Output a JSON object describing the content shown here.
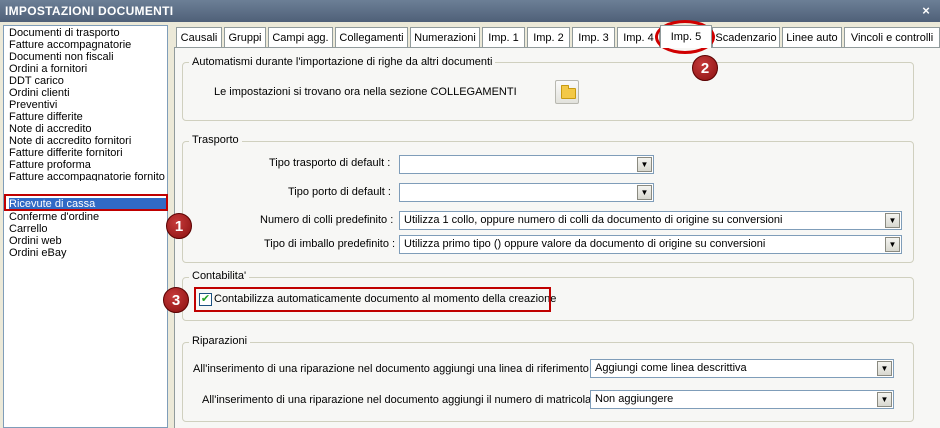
{
  "window": {
    "title": "IMPOSTAZIONI DOCUMENTI",
    "close_label": "×"
  },
  "sidebar": {
    "items": [
      {
        "label": "Documenti di trasporto"
      },
      {
        "label": "Fatture accompagnatorie"
      },
      {
        "label": "Documenti non fiscali"
      },
      {
        "label": "Ordini a fornitori"
      },
      {
        "label": "DDT carico"
      },
      {
        "label": "Ordini clienti"
      },
      {
        "label": "Preventivi"
      },
      {
        "label": "Fatture differite"
      },
      {
        "label": "Note di accredito"
      },
      {
        "label": "Note di accredito fornitori"
      },
      {
        "label": "Fatture differite fornitori"
      },
      {
        "label": "Fatture proforma"
      },
      {
        "label": "Fatture accompagnatorie fornito"
      },
      {
        "label": "Ricevute di cassa"
      },
      {
        "label": "Conferme d'ordine"
      },
      {
        "label": "Carrello"
      },
      {
        "label": "Ordini web"
      },
      {
        "label": "Ordini eBay"
      }
    ],
    "selected": "Ricevute di cassa"
  },
  "tabs": [
    {
      "label": "Causali"
    },
    {
      "label": "Gruppi"
    },
    {
      "label": "Campi agg."
    },
    {
      "label": "Collegamenti"
    },
    {
      "label": "Numerazioni"
    },
    {
      "label": "Imp. 1"
    },
    {
      "label": "Imp. 2"
    },
    {
      "label": "Imp. 3"
    },
    {
      "label": "Imp. 4"
    },
    {
      "label": "Imp. 5"
    },
    {
      "label": "Scadenzario"
    },
    {
      "label": "Linee auto"
    },
    {
      "label": "Vincoli e controlli"
    }
  ],
  "active_tab": "Imp. 5",
  "automatismi": {
    "title": "Automatismi durante l'importazione di righe da altri documenti",
    "info": "Le impostazioni si trovano ora nella sezione COLLEGAMENTI",
    "button_icon": "folder-icon"
  },
  "trasporto": {
    "title": "Trasporto",
    "tipo_trasporto_label": "Tipo trasporto di default :",
    "tipo_trasporto_value": "",
    "tipo_porto_label": "Tipo porto di default :",
    "tipo_porto_value": "",
    "colli_label": "Numero di colli predefinito :",
    "colli_value": "Utilizza 1 collo, oppure numero di colli da documento di origine su conversioni",
    "imballo_label": "Tipo di imballo predefinito :",
    "imballo_value": "Utilizza primo tipo () oppure valore da documento di origine su conversioni"
  },
  "contabilita": {
    "title": "Contabilita'",
    "checkbox_label": "Contabilizza automaticamente documento al momento della creazione",
    "checked": true
  },
  "riparazioni": {
    "title": "Riparazioni",
    "linea_label": "All'inserimento di una riparazione nel documento aggiungi una linea di riferimento :",
    "linea_value": "Aggiungi come linea descrittiva",
    "matricola_label": "All'inserimento di una riparazione nel documento aggiungi il numero di matricola :",
    "matricola_value": "Non aggiungere"
  },
  "annotations": {
    "badge1": "1",
    "badge2": "2",
    "badge3": "3"
  },
  "colors": {
    "selection": "#316ac5",
    "annotation": "#c00000",
    "titlebar": "#5a6b82"
  }
}
